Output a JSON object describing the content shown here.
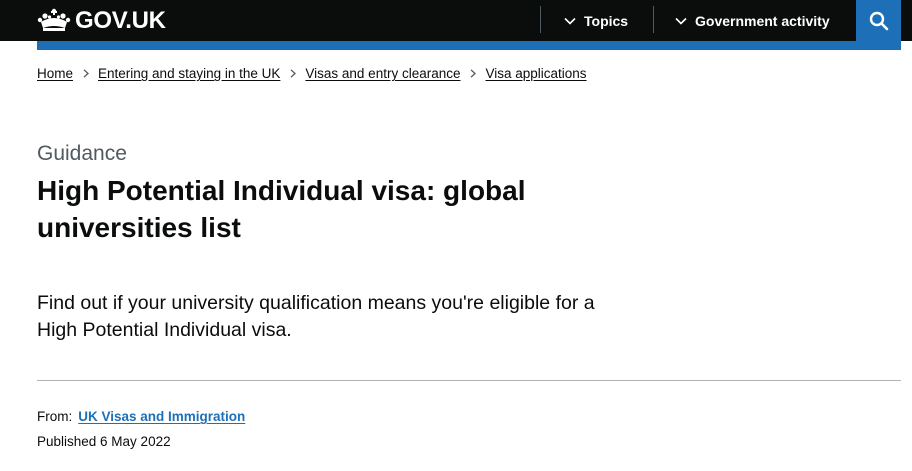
{
  "header": {
    "logo_text": "GOV.UK",
    "nav": {
      "topics_label": "Topics",
      "government_activity_label": "Government activity"
    },
    "search_icon": "search-icon",
    "accent_color": "#1d70b8"
  },
  "breadcrumbs": [
    {
      "label": "Home"
    },
    {
      "label": "Entering and staying in the UK"
    },
    {
      "label": "Visas and entry clearance"
    },
    {
      "label": "Visa applications"
    }
  ],
  "page": {
    "caption": "Guidance",
    "title": "High Potential Individual visa: global universities list",
    "lead": "Find out if your university qualification means you're eligible for a High Potential Individual visa."
  },
  "metadata": {
    "from_label": "From:",
    "from_link": "UK Visas and Immigration",
    "published": "Published 6 May 2022"
  }
}
